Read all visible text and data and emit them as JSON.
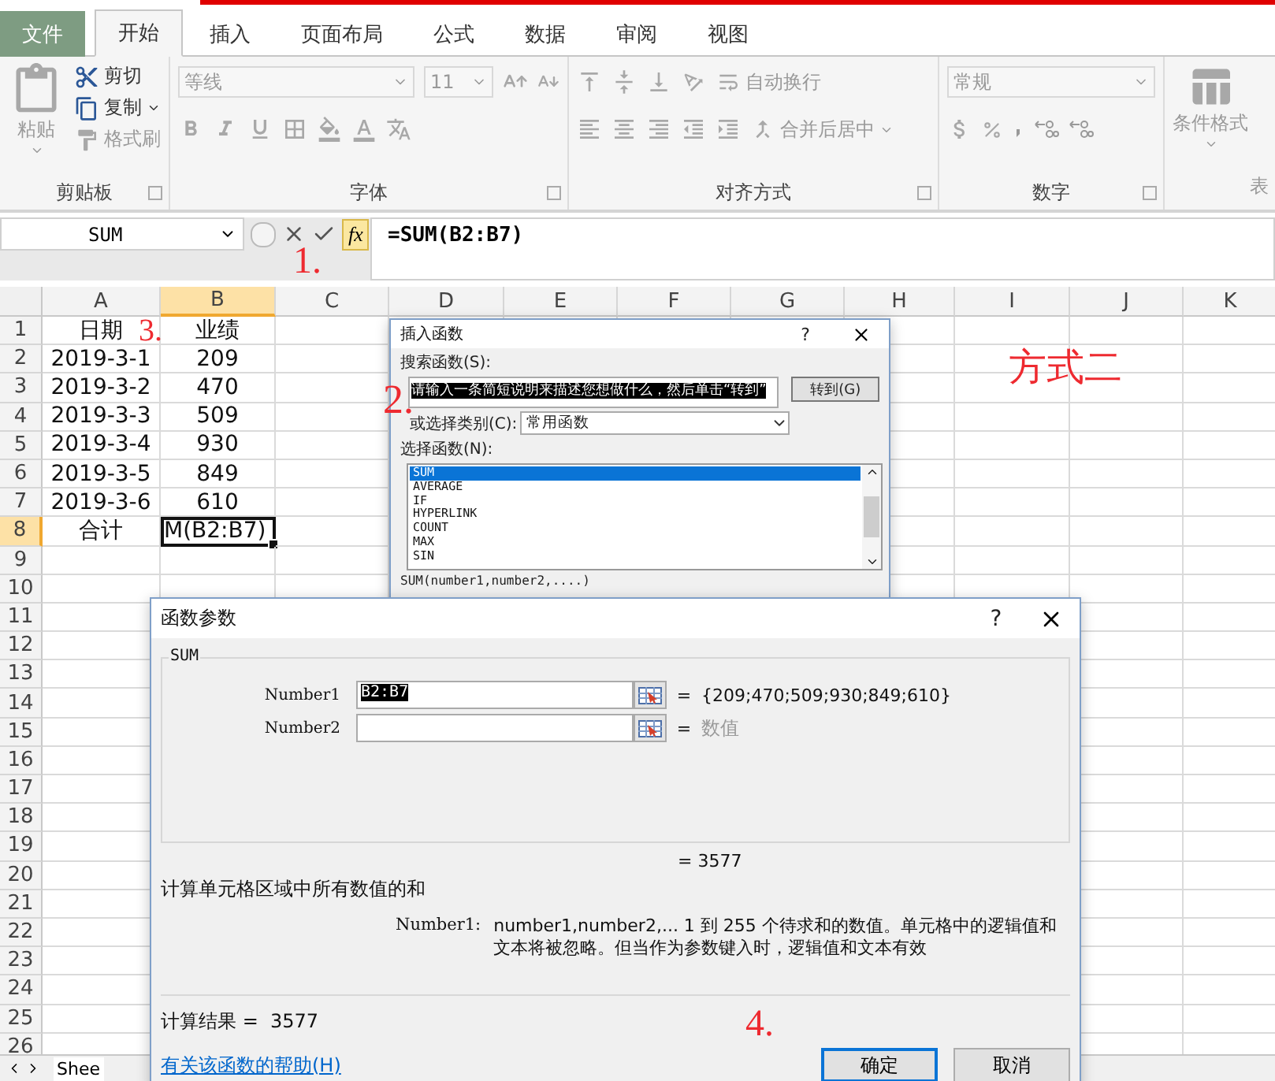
{
  "ribbon_tabs": [
    {
      "label": "文件",
      "kind": "file",
      "selected": false
    },
    {
      "label": "开始",
      "kind": "tab",
      "selected": true
    },
    {
      "label": "插入",
      "kind": "tab",
      "selected": false
    },
    {
      "label": "页面布局",
      "kind": "tab",
      "selected": false
    },
    {
      "label": "公式",
      "kind": "tab",
      "selected": false
    },
    {
      "label": "数据",
      "kind": "tab",
      "selected": false
    },
    {
      "label": "审阅",
      "kind": "tab",
      "selected": false
    },
    {
      "label": "视图",
      "kind": "tab",
      "selected": false
    }
  ],
  "clipboard": {
    "label": "剪贴板",
    "paste": {
      "label": "粘贴",
      "disabled": true
    },
    "cut": {
      "label": "剪切",
      "disabled": false
    },
    "copy": {
      "label": "复制",
      "disabled": false
    },
    "painter": {
      "label": "格式刷",
      "disabled": true
    }
  },
  "font": {
    "label": "字体",
    "disabled": true,
    "font_name": "等线",
    "font_size": "11"
  },
  "alignment": {
    "label": "对齐方式",
    "disabled": true,
    "wrap": "自动换行",
    "merge": "合并后居中"
  },
  "number": {
    "label": "数字",
    "disabled": true,
    "format": "常规"
  },
  "styles": {
    "disabled": true,
    "conditional": "条件格式",
    "cut_label": "表"
  },
  "formula_bar": {
    "name_box": "SUM",
    "fx": "fx",
    "formula": "=SUM(B2:B7)"
  },
  "sheet": {
    "columns": [
      {
        "label": "A",
        "selected": false
      },
      {
        "label": "B",
        "selected": true
      },
      {
        "label": "C",
        "selected": false
      },
      {
        "label": "D",
        "selected": false
      },
      {
        "label": "E",
        "selected": false
      },
      {
        "label": "F",
        "selected": false
      },
      {
        "label": "G",
        "selected": false
      },
      {
        "label": "H",
        "selected": false
      },
      {
        "label": "I",
        "selected": false
      },
      {
        "label": "J",
        "selected": false
      },
      {
        "label": "K",
        "selected": false
      }
    ],
    "rows": [
      {
        "label": "1",
        "selected": false,
        "cells": [
          {
            "text": "日期",
            "active": false
          },
          {
            "text": "业绩",
            "active": false
          }
        ]
      },
      {
        "label": "2",
        "selected": false,
        "cells": [
          {
            "text": "2019-3-1",
            "active": false
          },
          {
            "text": "209",
            "active": false
          }
        ]
      },
      {
        "label": "3",
        "selected": false,
        "cells": [
          {
            "text": "2019-3-2",
            "active": false
          },
          {
            "text": "470",
            "active": false
          }
        ]
      },
      {
        "label": "4",
        "selected": false,
        "cells": [
          {
            "text": "2019-3-3",
            "active": false
          },
          {
            "text": "509",
            "active": false
          }
        ]
      },
      {
        "label": "5",
        "selected": false,
        "cells": [
          {
            "text": "2019-3-4",
            "active": false
          },
          {
            "text": "930",
            "active": false
          }
        ]
      },
      {
        "label": "6",
        "selected": false,
        "cells": [
          {
            "text": "2019-3-5",
            "active": false
          },
          {
            "text": "849",
            "active": false
          }
        ]
      },
      {
        "label": "7",
        "selected": false,
        "cells": [
          {
            "text": "2019-3-6",
            "active": false
          },
          {
            "text": "610",
            "active": false
          }
        ]
      },
      {
        "label": "8",
        "selected": true,
        "cells": [
          {
            "text": "合计",
            "active": false
          },
          {
            "text": "M(B2:B7)",
            "active": true
          }
        ]
      },
      {
        "label": "9",
        "selected": false
      },
      {
        "label": "10",
        "selected": false
      },
      {
        "label": "11",
        "selected": false
      },
      {
        "label": "12",
        "selected": false
      },
      {
        "label": "13",
        "selected": false
      },
      {
        "label": "14",
        "selected": false
      },
      {
        "label": "15",
        "selected": false
      },
      {
        "label": "16",
        "selected": false
      },
      {
        "label": "17",
        "selected": false
      },
      {
        "label": "18",
        "selected": false
      },
      {
        "label": "19",
        "selected": false
      },
      {
        "label": "20",
        "selected": false
      },
      {
        "label": "21",
        "selected": false
      },
      {
        "label": "22",
        "selected": false
      },
      {
        "label": "23",
        "selected": false
      },
      {
        "label": "24",
        "selected": false
      },
      {
        "label": "25",
        "selected": false
      },
      {
        "label": "26",
        "selected": false
      }
    ],
    "sheet_tab": "Shee"
  },
  "annotations": {
    "step1": "1.",
    "step2": "2.",
    "step3": "3.",
    "step4": "4.",
    "note": "方式二"
  },
  "insert_dialog": {
    "title": "插入函数",
    "help": "?",
    "search_label": "搜索函数(S):",
    "search_value": "请输入一条简短说明来描述您想做什么，然后单击“转到”",
    "go_button": "转到(G)",
    "category_label": "或选择类别(C):",
    "category": "常用函数",
    "list_label": "选择函数(N):",
    "functions": [
      {
        "name": "SUM",
        "selected": true
      },
      {
        "name": "AVERAGE",
        "selected": false
      },
      {
        "name": "IF",
        "selected": false
      },
      {
        "name": "HYPERLINK",
        "selected": false
      },
      {
        "name": "COUNT",
        "selected": false
      },
      {
        "name": "MAX",
        "selected": false
      },
      {
        "name": "SIN",
        "selected": false
      }
    ],
    "signature": "SUM(number1,number2,....)"
  },
  "args_dialog": {
    "title": "函数参数",
    "help": "?",
    "group": "SUM",
    "args": [
      {
        "label": "Number1",
        "value": "B2:B7",
        "equals": "=",
        "result": "{209;470;509;930;849;610}",
        "hint": false
      },
      {
        "label": "Number2",
        "equals": "=",
        "result": "数值",
        "hint": true
      }
    ],
    "total": "= 3577",
    "description": "计算单元格区域中所有数值的和",
    "param_name": "Number1:",
    "param_text": "number1,number2,...   1 到 255 个待求和的数值。单元格中的逻辑值和文本将被忽略。但当作为参数键入时，逻辑值和文本有效",
    "result_line": "计算结果 =  3577",
    "help_link": "有关该函数的帮助(H)",
    "ok": "确定",
    "cancel": "取消"
  }
}
